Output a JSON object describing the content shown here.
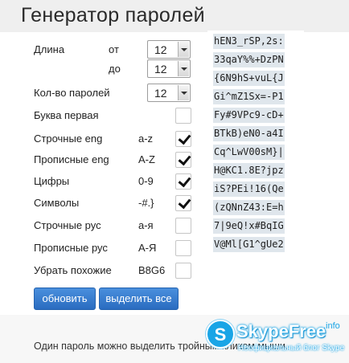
{
  "title": "Генератор паролей",
  "length": {
    "label": "Длина",
    "from_label": "от",
    "to_label": "до",
    "from_value": "12",
    "to_value": "12"
  },
  "count": {
    "label": "Кол-во паролей",
    "value": "12"
  },
  "options": [
    {
      "label": "Буква первая",
      "range": "",
      "checked": false
    },
    {
      "label": "Строчные eng",
      "range": "a-z",
      "checked": true
    },
    {
      "label": "Прописные eng",
      "range": "A-Z",
      "checked": true
    },
    {
      "label": "Цифры",
      "range": "0-9",
      "checked": true
    },
    {
      "label": "Символы",
      "range": "-#.}",
      "checked": true
    },
    {
      "label": "Строчные рус",
      "range": "а-я",
      "checked": false
    },
    {
      "label": "Прописные рус",
      "range": "А-Я",
      "checked": false
    },
    {
      "label": "Убрать похожие",
      "range": "B8G6",
      "checked": false
    }
  ],
  "buttons": {
    "refresh": "обновить",
    "select_all": "выделить все"
  },
  "passwords": [
    "hEN3_rSP,2s:",
    "33qaY%%+DzPN",
    "{6N9hS+vuL{J",
    "Gi^mZ1Sx=-P1",
    "Fy#9VPc9-cD+",
    "BTkB)eN0-a4I",
    "Cq^LwV00sM}|",
    "H@KC1.8E?jpz",
    "iS?PEi!16(Qe",
    "(zQNnZ43:E=h",
    "7|9eQ!x#BqIG",
    "V@Ml[G1^gUe2"
  ],
  "note": "Один пароль можно выделить тройным кликом мыши.",
  "watermark": {
    "logo_letter": "S",
    "name": "SkypeFree",
    "domain": ".info",
    "tagline": "Неофициальный блог Skype"
  }
}
